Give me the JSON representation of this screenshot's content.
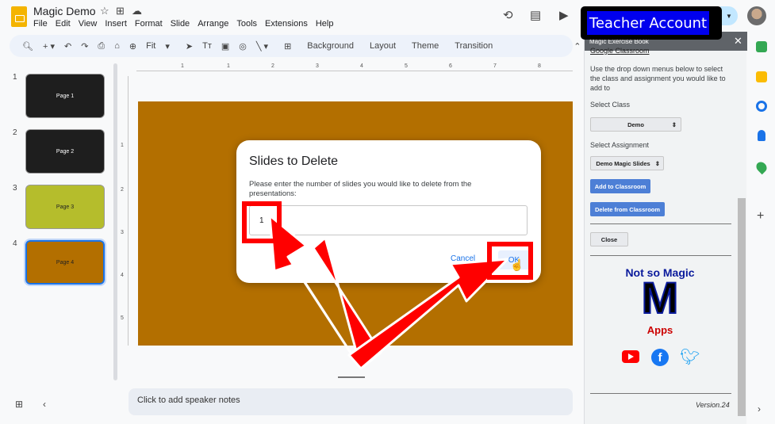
{
  "app": {
    "doc_title": "Magic Demo",
    "menu": [
      "File",
      "Edit",
      "View",
      "Insert",
      "Format",
      "Slide",
      "Arrange",
      "Tools",
      "Extensions",
      "Help"
    ],
    "teacher_badge": "Teacher Account"
  },
  "toolbar": {
    "zoom": "Fit",
    "background": "Background",
    "layout": "Layout",
    "theme": "Theme",
    "transition": "Transition"
  },
  "slides": [
    {
      "num": "1",
      "label": "Page 1",
      "color": "#1e1e1e",
      "text_color": "#ffffff"
    },
    {
      "num": "2",
      "label": "Page 2",
      "color": "#1e1e1e",
      "text_color": "#ffffff"
    },
    {
      "num": "3",
      "label": "Page 3",
      "color": "#b5bd2c",
      "text_color": "#222222"
    },
    {
      "num": "4",
      "label": "Page 4",
      "color": "#b36f00",
      "text_color": "#222222"
    }
  ],
  "ruler": {
    "h": [
      "1",
      "1",
      "2",
      "3",
      "4",
      "5",
      "6",
      "7",
      "8",
      "9"
    ],
    "v": [
      "1",
      "2",
      "3",
      "4",
      "5"
    ]
  },
  "notes_placeholder": "Click to add speaker notes",
  "dialog": {
    "title": "Slides to Delete",
    "prompt": "Please enter the number of slides you would like to delete from the presentations:",
    "input_value": "1",
    "cancel": "Cancel",
    "ok": "OK"
  },
  "panel": {
    "header": "Magic Exercise Book",
    "link": "Google Classroom",
    "intro": "Use the drop down menus below to select the class and assignment you would like to add to",
    "select_class_label": "Select Class",
    "class_value": "Demo",
    "select_assignment_label": "Select Assignment",
    "assignment_value": "Demo Magic Slides",
    "add_button": "Add to Classroom",
    "delete_button": "Delete from Classroom",
    "close_button": "Close",
    "brand_line1": "Not so Magic",
    "brand_letter": "M",
    "brand_line2": "Apps",
    "version": "Version.24"
  },
  "colors": {
    "slide": "#b36f00",
    "highlight": "#ff0000",
    "brand_blue": "#0a1a9c",
    "brand_red": "#cc0000"
  }
}
